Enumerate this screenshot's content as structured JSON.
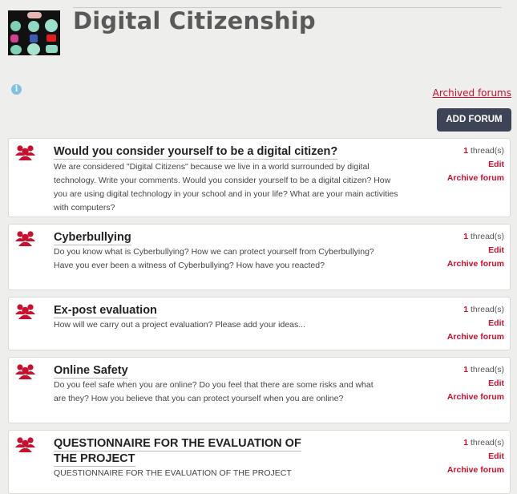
{
  "page": {
    "title": "Digital Citizenship",
    "archived_link": "Archived forums",
    "add_forum_label": "ADD FORUM",
    "info_glyph": "i"
  },
  "colors": {
    "accent": "#c8102e",
    "button": "#3e4458",
    "info": "#7dc2e6"
  },
  "forums": [
    {
      "name": "Would you consider yourself to be a digital citizen?",
      "description": "We are considered \"Digital Citizens\" because we live in a world surrounded by digital technology. Write your comments. Would you consider yourself to be a digital citizen? How you are using digital technology in your school and in your life? What are your main activities with computers?",
      "thread_count": "1",
      "thread_suffix": "thread(s)",
      "edit_label": "Edit",
      "archive_label": "Archive forum",
      "icon": "users-group-icon"
    },
    {
      "name": "Cyberbullying",
      "description": "Do you know what is Cyberbullying? How we can protect yourself from Cyberbullying? Have you ever been a witness of Cyberbullying? How have you reacted?",
      "thread_count": "1",
      "thread_suffix": "thread(s)",
      "edit_label": "Edit",
      "archive_label": "Archive forum",
      "icon": "users-group-icon"
    },
    {
      "name": "Ex-post evaluation",
      "description": "How will we carry out a project evaluation? Please add your ideas...",
      "thread_count": "1",
      "thread_suffix": "thread(s)",
      "edit_label": "Edit",
      "archive_label": "Archive forum",
      "icon": "users-group-icon"
    },
    {
      "name": "Online Safety",
      "description": "Do you feel safe when you are online? Do you feel that there are some risks and what are they? How you believe that you can protect yourself when you are online?",
      "thread_count": "1",
      "thread_suffix": "thread(s)",
      "edit_label": "Edit",
      "archive_label": "Archive forum",
      "icon": "users-group-icon"
    },
    {
      "name": "QUESTIONNAIRE FOR THE EVALUATION OF THE PROJECT",
      "description": "QUESTIONNAIRE FOR THE EVALUATION OF THE PROJECT",
      "thread_count": "1",
      "thread_suffix": "thread(s)",
      "edit_label": "Edit",
      "archive_label": "Archive forum",
      "icon": "users-group-icon"
    }
  ]
}
